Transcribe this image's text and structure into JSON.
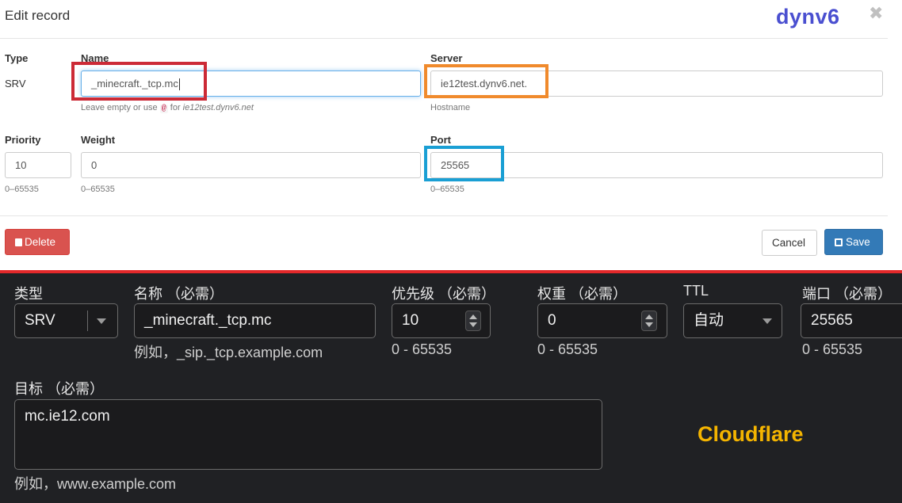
{
  "dynv6": {
    "title": "Edit record",
    "brand": "dynv6",
    "close": "✖",
    "type_label": "Type",
    "type_value": "SRV",
    "name_label": "Name",
    "name_value": "_minecraft._tcp.mc",
    "name_help_prefix": "Leave empty or use",
    "name_help_at": "@",
    "name_help_for": "for",
    "name_help_domain": "ie12test.dynv6.net",
    "server_label": "Server",
    "server_value": "ie12test.dynv6.net.",
    "server_help": "Hostname",
    "priority_label": "Priority",
    "priority_value": "10",
    "priority_help": "0–65535",
    "weight_label": "Weight",
    "weight_value": "0",
    "weight_help": "0–65535",
    "port_label": "Port",
    "port_value": "25565",
    "port_help": "0–65535",
    "delete_label": "Delete",
    "cancel_label": "Cancel",
    "save_label": "Save"
  },
  "cloudflare": {
    "brand": "Cloudflare",
    "type_label": "类型",
    "type_value": "SRV",
    "name_label": "名称 （必需）",
    "name_value": "_minecraft._tcp.mc",
    "name_help": "例如，_sip._tcp.example.com",
    "priority_label": "优先级 （必需）",
    "priority_value": "10",
    "priority_help": "0 - 65535",
    "weight_label": "权重 （必需）",
    "weight_value": "0",
    "weight_help": "0 - 65535",
    "ttl_label": "TTL",
    "ttl_value": "自动",
    "port_label": "端口 （必需）",
    "port_value": "25565",
    "port_help": "0 - 65535",
    "target_label": "目标 （必需）",
    "target_value": "mc.ie12.com",
    "target_help": "例如，www.example.com"
  },
  "colors": {
    "name_highlight": "#cc2a36",
    "server_highlight": "#f08a2c",
    "port_highlight": "#1a9fd4",
    "divider": "#e3282a",
    "cloudflare_brand": "#f4b400",
    "dynv6_brand": "#4a4fd0"
  }
}
